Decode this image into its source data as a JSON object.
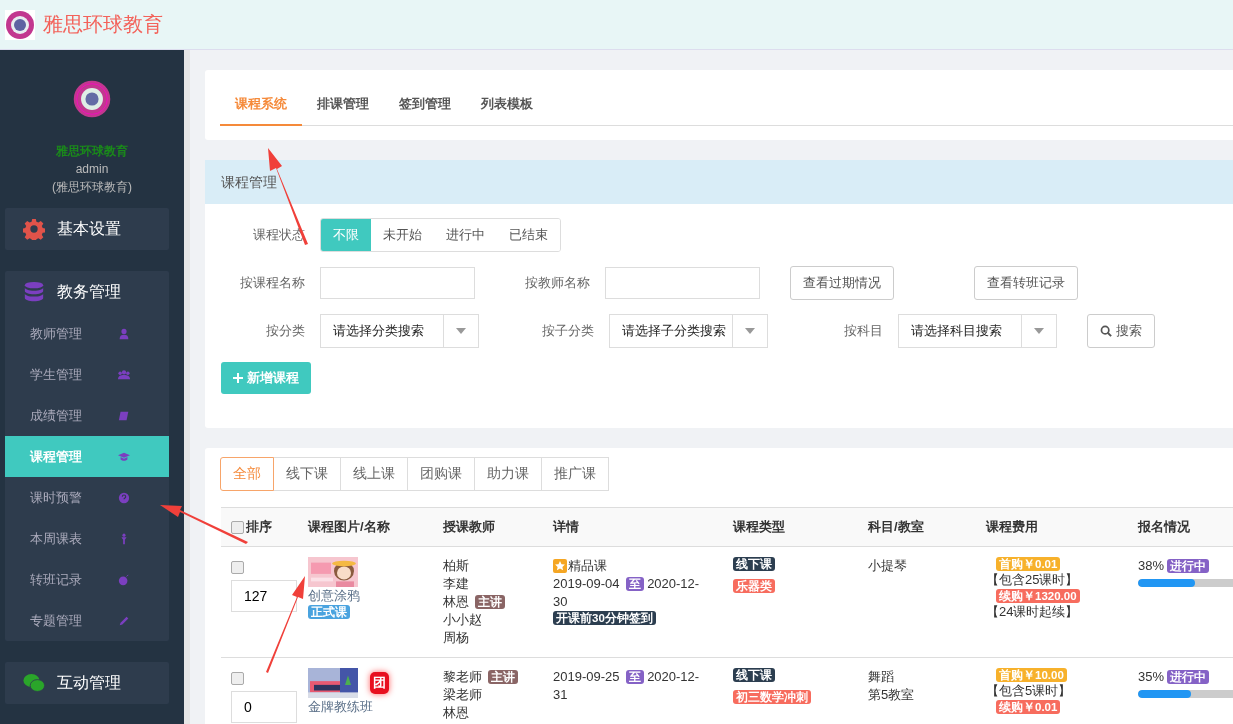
{
  "header": {
    "title": "雅思环球教育"
  },
  "sidebar": {
    "org_name": "雅思环球教育",
    "user": "admin",
    "org_note": "(雅思环球教育)",
    "groups": [
      {
        "label": "基本设置"
      },
      {
        "label": "教务管理",
        "items": [
          {
            "label": "教师管理",
            "selected": false
          },
          {
            "label": "学生管理",
            "selected": false
          },
          {
            "label": "成绩管理",
            "selected": false
          },
          {
            "label": "课程管理",
            "selected": true
          },
          {
            "label": "课时预警",
            "selected": false
          },
          {
            "label": "本周课表",
            "selected": false
          },
          {
            "label": "转班记录",
            "selected": false
          },
          {
            "label": "专题管理",
            "selected": false
          }
        ]
      },
      {
        "label": "互动管理"
      }
    ]
  },
  "tabs": [
    {
      "label": "课程系统",
      "selected": true
    },
    {
      "label": "排课管理",
      "selected": false
    },
    {
      "label": "签到管理",
      "selected": false
    },
    {
      "label": "列表模板",
      "selected": false
    }
  ],
  "filter_panel": {
    "title": "课程管理",
    "status_label": "课程状态",
    "status_options": [
      {
        "label": "不限",
        "selected": true
      },
      {
        "label": "未开始",
        "selected": false
      },
      {
        "label": "进行中",
        "selected": false
      },
      {
        "label": "已结束",
        "selected": false
      }
    ],
    "course_name_label": "按课程名称",
    "teacher_name_label": "按教师名称",
    "expiry_button": "查看过期情况",
    "transfer_button": "查看转班记录",
    "category_label": "按分类",
    "category_placeholder": "请选择分类搜索",
    "subcategory_label": "按子分类",
    "subcategory_placeholder": "请选择子分类搜索",
    "subject_label": "按科目",
    "subject_placeholder": "请选择科目搜索",
    "search_button": "搜索",
    "add_button": "新增课程"
  },
  "type_tabs": [
    {
      "label": "全部",
      "selected": true
    },
    {
      "label": "线下课",
      "selected": false
    },
    {
      "label": "线上课",
      "selected": false
    },
    {
      "label": "团购课",
      "selected": false
    },
    {
      "label": "助力课",
      "selected": false
    },
    {
      "label": "推广课",
      "selected": false
    }
  ],
  "table": {
    "header_checked": false,
    "columns": [
      "排序",
      "课程图片/名称",
      "授课教师",
      "详情",
      "课程类型",
      "科目/教室",
      "课程费用",
      "报名情况"
    ],
    "rows": [
      {
        "checked": false,
        "sort": "127",
        "name": "创意涂鸦",
        "tag": "正式课",
        "group_badge": null,
        "teachers": [
          {
            "name": "柏斯",
            "lead": false
          },
          {
            "name": "李建",
            "lead": false
          },
          {
            "name": "林恩",
            "lead": true
          },
          {
            "name": "小小赵",
            "lead": false
          },
          {
            "name": "周杨",
            "lead": false
          }
        ],
        "lead_label": "主讲",
        "premium": "精品课",
        "start": "2019-09-04",
        "sep": "至",
        "end_a": "2020-12-",
        "end_b": "30",
        "signin": "开课前30分钟签到",
        "types": [
          {
            "label": "线下课",
            "kind": "mode"
          },
          {
            "label": "乐器类",
            "kind": "category"
          }
        ],
        "subject": [
          "小提琴"
        ],
        "first_buy": "首购￥0.01",
        "includes": "【包含25课时】",
        "renew": "续购￥1320.00",
        "renew_from": "【24课时起续】",
        "percent": "38%",
        "status": "进行中",
        "level": 0.38
      },
      {
        "checked": false,
        "sort": "0",
        "name": "金牌教练班",
        "tag": null,
        "group_badge": "团",
        "teachers": [
          {
            "name": "黎老师",
            "lead": true
          },
          {
            "name": "梁老师",
            "lead": false
          },
          {
            "name": "林恩",
            "lead": false
          }
        ],
        "lead_label": "主讲",
        "premium": null,
        "start": "2019-09-25",
        "sep": "至",
        "end_a": "2020-12-",
        "end_b": "31",
        "signin": null,
        "types": [
          {
            "label": "线下课",
            "kind": "mode"
          },
          {
            "label": "初三数学冲刺",
            "kind": "category"
          }
        ],
        "subject": [
          "舞蹈",
          "第5教室"
        ],
        "first_buy": "首购￥10.00",
        "includes": "【包含5课时】",
        "renew": "续购￥0.01",
        "renew_from": null,
        "percent": "35%",
        "status": "进行中",
        "level": 0.35
      }
    ]
  }
}
